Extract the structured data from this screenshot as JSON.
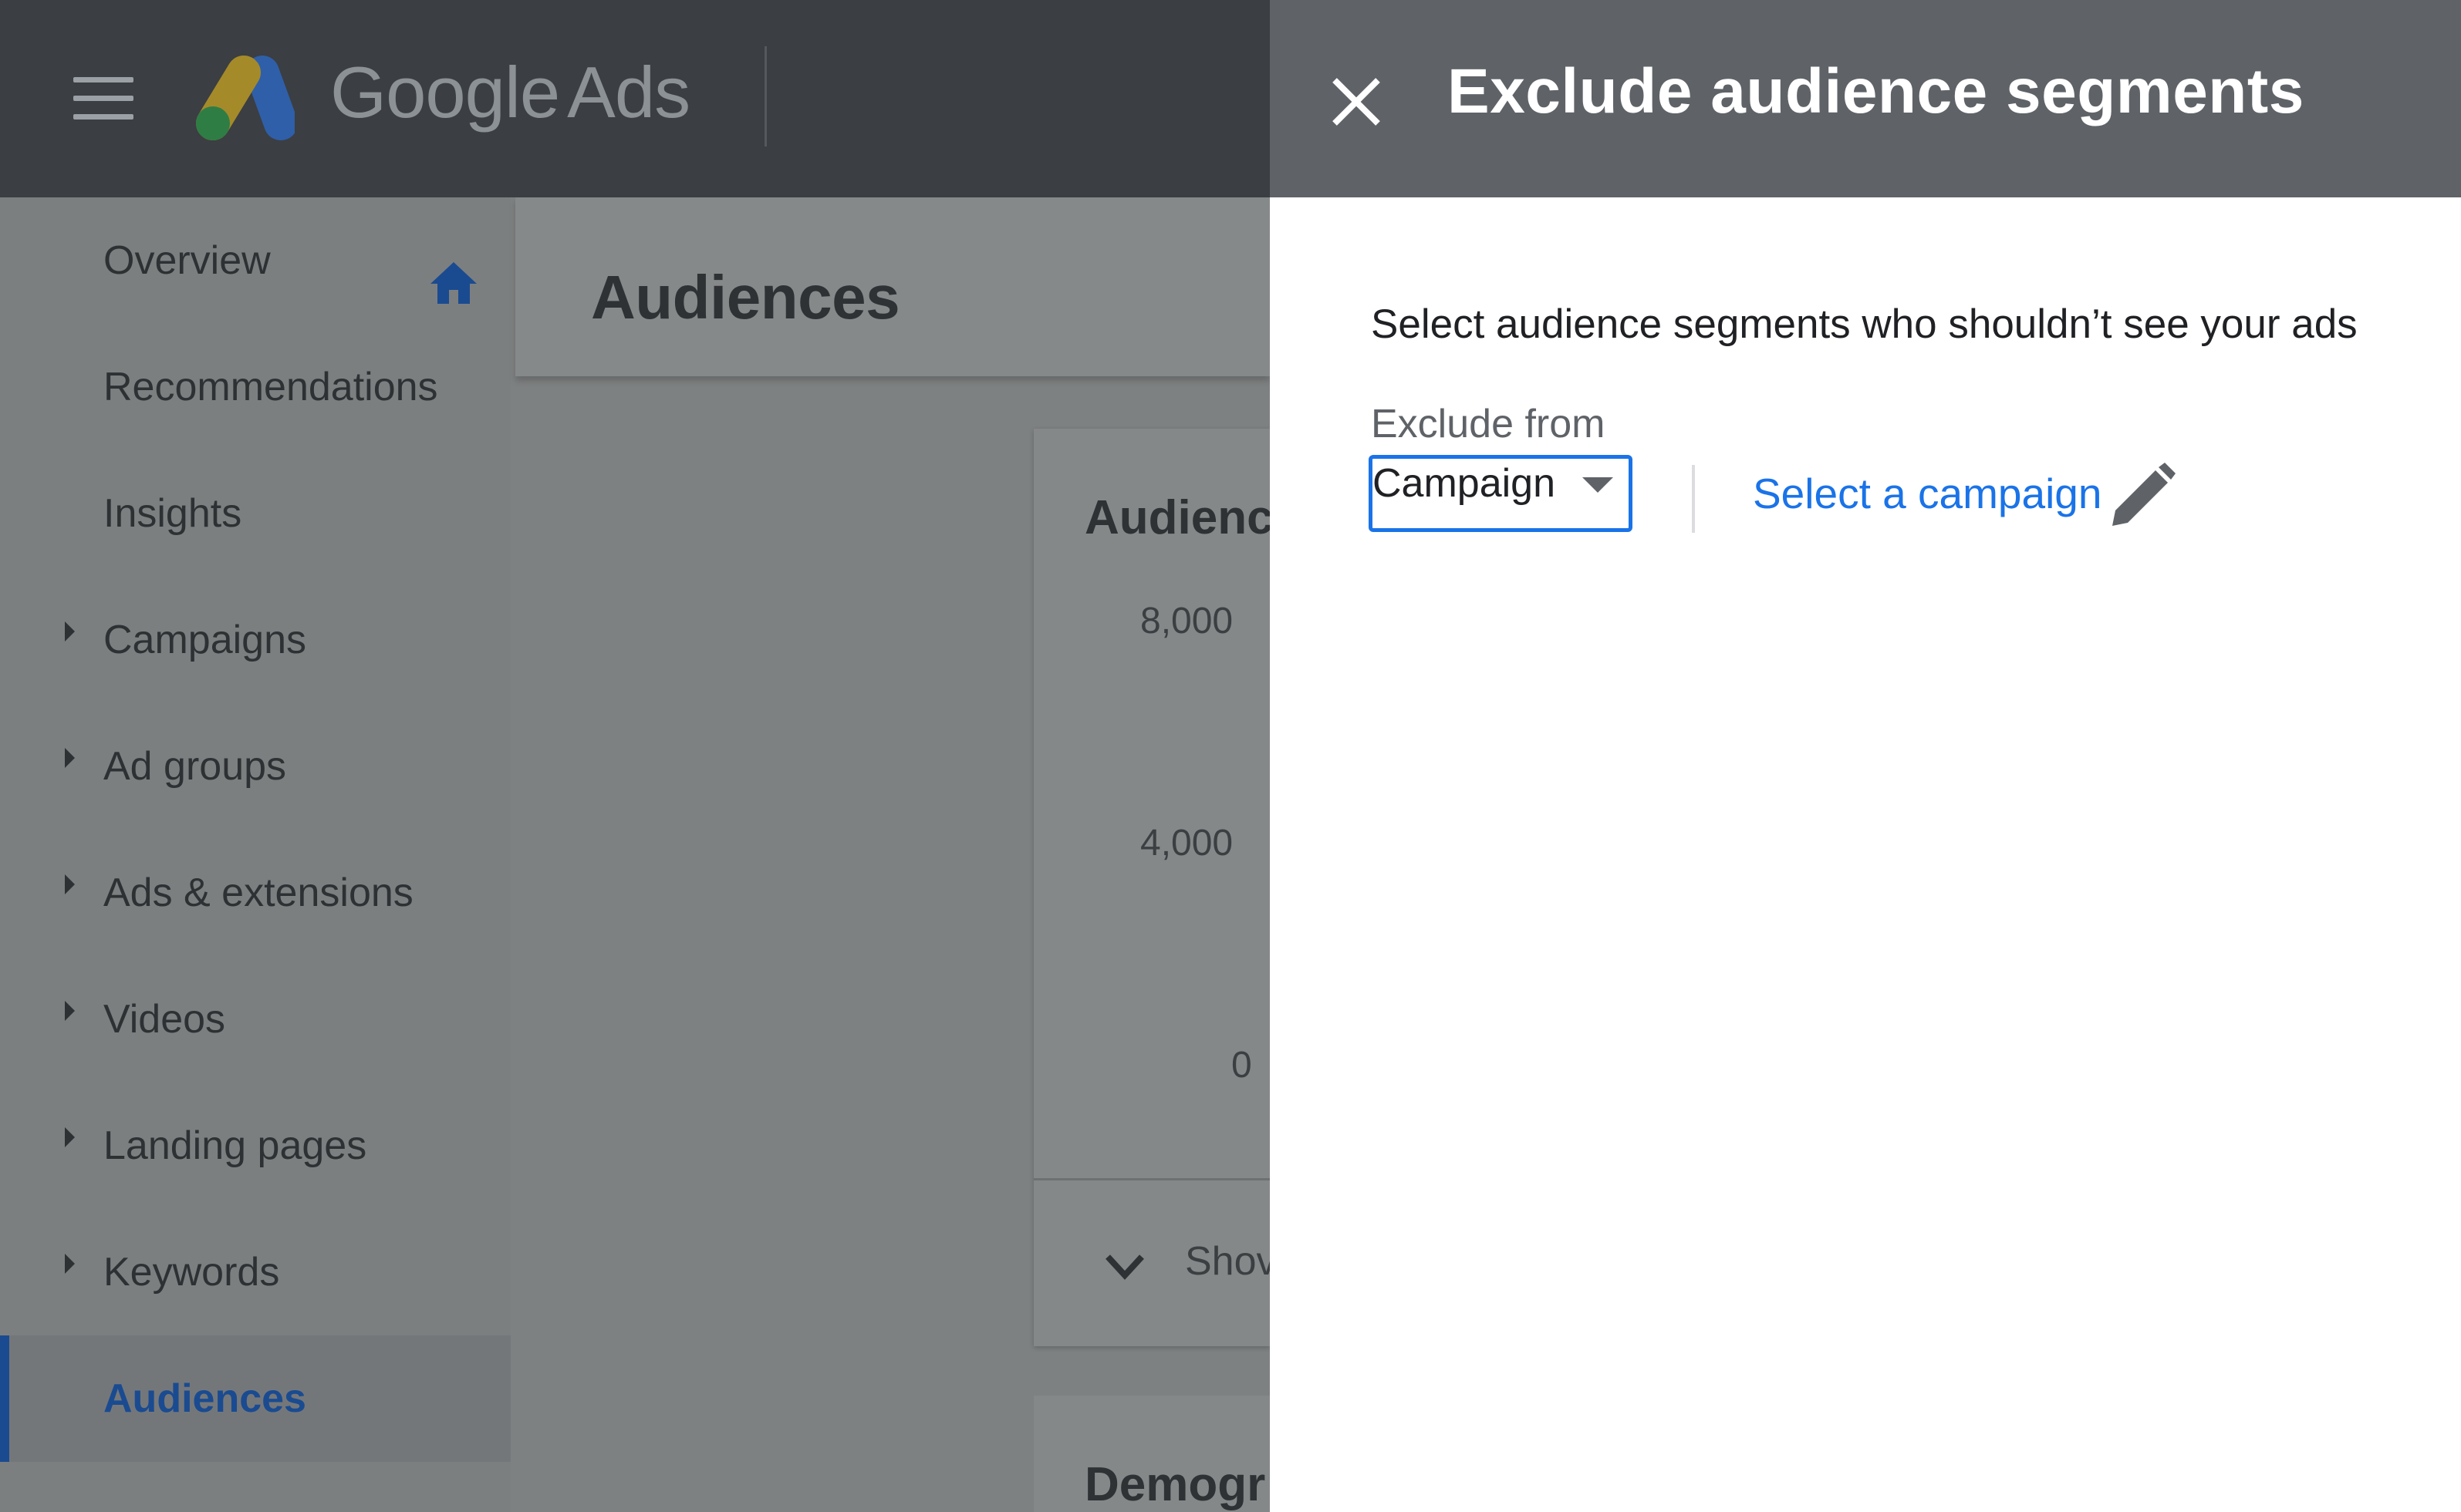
{
  "app": {
    "brand_name": "Google",
    "brand_product": "Ads",
    "menu_icon": "hamburger-menu-icon",
    "logo": "google-ads-logo"
  },
  "sidebar": {
    "items": [
      {
        "label": "Overview",
        "icon": "home-icon",
        "expandable": false,
        "active": false
      },
      {
        "label": "Recommendations",
        "expandable": false,
        "active": false
      },
      {
        "label": "Insights",
        "expandable": false,
        "active": false
      },
      {
        "label": "Campaigns",
        "expandable": true,
        "active": false
      },
      {
        "label": "Ad groups",
        "expandable": true,
        "active": false
      },
      {
        "label": "Ads & extensions",
        "expandable": true,
        "active": false
      },
      {
        "label": "Videos",
        "expandable": true,
        "active": false
      },
      {
        "label": "Landing pages",
        "expandable": true,
        "active": false
      },
      {
        "label": "Keywords",
        "expandable": true,
        "active": false
      },
      {
        "label": "Audiences",
        "expandable": false,
        "active": true
      }
    ]
  },
  "main": {
    "page_title": "Audiences",
    "card": {
      "title": "Audienc",
      "y_ticks": [
        "8,000",
        "4,000",
        "0"
      ],
      "show_label": "Shov"
    },
    "card2": {
      "title": "Demogr"
    }
  },
  "panel": {
    "title": "Exclude audience segments",
    "close_icon": "close-icon",
    "description": "Select audience segments who shouldn’t see your ads",
    "exclude_from_label": "Exclude from",
    "exclude_from_value": "Campaign",
    "select_campaign_link": "Select a campaign",
    "edit_icon": "pencil-icon"
  },
  "colors": {
    "header_dark": "#3b3e42",
    "panel_header": "#5f6368",
    "accent_blue": "#1a73e8",
    "active_nav": "#1a4b91"
  }
}
